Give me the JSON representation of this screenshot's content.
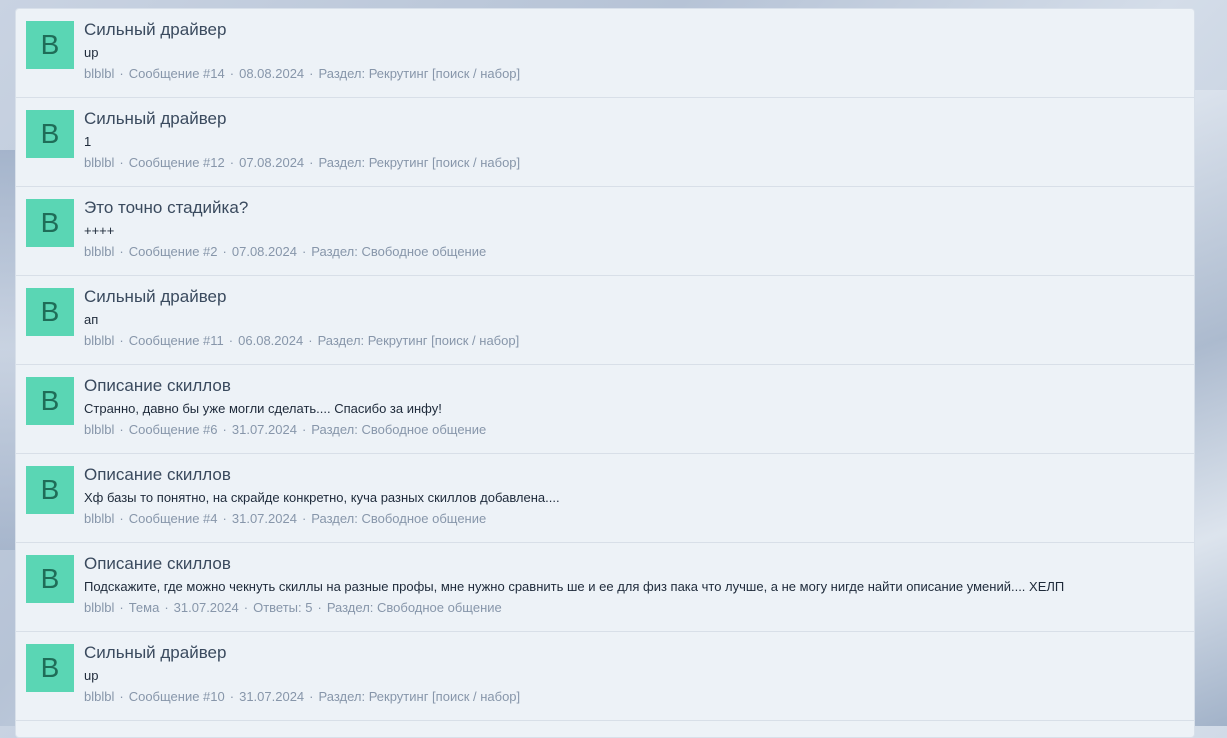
{
  "results": [
    {
      "avatar_letter": "B",
      "title": "Сильный драйвер",
      "snippet": "up",
      "author": "blblbl",
      "type": "Сообщение #14",
      "date": "08.08.2024",
      "extra": "",
      "section": "Раздел: Рекрутинг [поиск / набор]"
    },
    {
      "avatar_letter": "B",
      "title": "Сильный драйвер",
      "snippet": "1",
      "author": "blblbl",
      "type": "Сообщение #12",
      "date": "07.08.2024",
      "extra": "",
      "section": "Раздел: Рекрутинг [поиск / набор]"
    },
    {
      "avatar_letter": "B",
      "title": "Это точно стадийка?",
      "snippet": "++++",
      "author": "blblbl",
      "type": "Сообщение #2",
      "date": "07.08.2024",
      "extra": "",
      "section": "Раздел: Свободное общение"
    },
    {
      "avatar_letter": "B",
      "title": "Сильный драйвер",
      "snippet": "ап",
      "author": "blblbl",
      "type": "Сообщение #11",
      "date": "06.08.2024",
      "extra": "",
      "section": "Раздел: Рекрутинг [поиск / набор]"
    },
    {
      "avatar_letter": "B",
      "title": "Описание скиллов",
      "snippet": "Странно, давно бы уже могли сделать.... Спасибо за инфу!",
      "author": "blblbl",
      "type": "Сообщение #6",
      "date": "31.07.2024",
      "extra": "",
      "section": "Раздел: Свободное общение"
    },
    {
      "avatar_letter": "B",
      "title": "Описание скиллов",
      "snippet": "Хф базы то понятно, на скрайде конкретно, куча разных скиллов добавлена....",
      "author": "blblbl",
      "type": "Сообщение #4",
      "date": "31.07.2024",
      "extra": "",
      "section": "Раздел: Свободное общение"
    },
    {
      "avatar_letter": "B",
      "title": "Описание скиллов",
      "snippet": "Подскажите, где можно чекнуть скиллы на разные профы, мне нужно сравнить ше и ее для физ пака что лучше, а не могу нигде найти описание умений.... ХЕЛП",
      "author": "blblbl",
      "type": "Тема",
      "date": "31.07.2024",
      "extra": "Ответы: 5",
      "section": "Раздел: Свободное общение"
    },
    {
      "avatar_letter": "B",
      "title": "Сильный драйвер",
      "snippet": "up",
      "author": "blblbl",
      "type": "Сообщение #10",
      "date": "31.07.2024",
      "extra": "",
      "section": "Раздел: Рекрутинг [поиск / набор]"
    }
  ]
}
